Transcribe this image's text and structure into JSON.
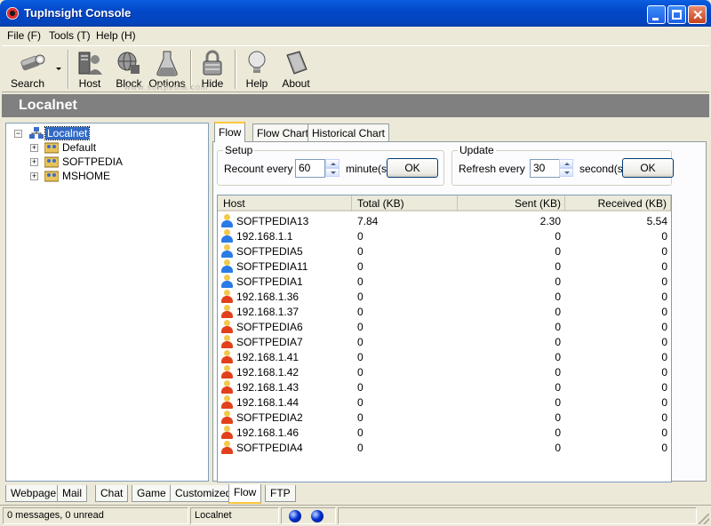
{
  "window": {
    "title": "TupInsight Console"
  },
  "menu": [
    "File (F)",
    "Tools (T)",
    "Help (H)"
  ],
  "toolbar": {
    "search": "Search",
    "host": "Host",
    "block": "Block",
    "options": "Options",
    "hide": "Hide",
    "help": "Help",
    "about": "About",
    "watermark": "www.softpedia.com"
  },
  "header": {
    "title": "Localnet"
  },
  "tree": {
    "root": "Localnet",
    "children": [
      "Default",
      "SOFTPEDIA",
      "MSHOME"
    ]
  },
  "tabs": [
    "Flow",
    "Flow Chart",
    "Historical Chart"
  ],
  "setup": {
    "legend": "Setup",
    "label": "Recount every",
    "value": "60",
    "unit": "minute(s)",
    "ok": "OK"
  },
  "update": {
    "legend": "Update",
    "label": "Refresh every",
    "value": "30",
    "unit": "second(s)",
    "ok": "OK"
  },
  "columns": [
    "Host",
    "Total (KB)",
    "Sent (KB)",
    "Received (KB)"
  ],
  "hosts": [
    {
      "host": "SOFTPEDIA13",
      "total": "7.84",
      "sent": "2.30",
      "received": "5.54",
      "status": "blue"
    },
    {
      "host": "192.168.1.1",
      "total": "0",
      "sent": "0",
      "received": "0",
      "status": "blue"
    },
    {
      "host": "SOFTPEDIA5",
      "total": "0",
      "sent": "0",
      "received": "0",
      "status": "blue"
    },
    {
      "host": "SOFTPEDIA11",
      "total": "0",
      "sent": "0",
      "received": "0",
      "status": "blue"
    },
    {
      "host": "SOFTPEDIA1",
      "total": "0",
      "sent": "0",
      "received": "0",
      "status": "blue"
    },
    {
      "host": "192.168.1.36",
      "total": "0",
      "sent": "0",
      "received": "0",
      "status": "red"
    },
    {
      "host": "192.168.1.37",
      "total": "0",
      "sent": "0",
      "received": "0",
      "status": "red"
    },
    {
      "host": "SOFTPEDIA6",
      "total": "0",
      "sent": "0",
      "received": "0",
      "status": "red"
    },
    {
      "host": "SOFTPEDIA7",
      "total": "0",
      "sent": "0",
      "received": "0",
      "status": "red"
    },
    {
      "host": "192.168.1.41",
      "total": "0",
      "sent": "0",
      "received": "0",
      "status": "red"
    },
    {
      "host": "192.168.1.42",
      "total": "0",
      "sent": "0",
      "received": "0",
      "status": "red"
    },
    {
      "host": "192.168.1.43",
      "total": "0",
      "sent": "0",
      "received": "0",
      "status": "red"
    },
    {
      "host": "192.168.1.44",
      "total": "0",
      "sent": "0",
      "received": "0",
      "status": "red"
    },
    {
      "host": "SOFTPEDIA2",
      "total": "0",
      "sent": "0",
      "received": "0",
      "status": "red"
    },
    {
      "host": "192.168.1.46",
      "total": "0",
      "sent": "0",
      "received": "0",
      "status": "red"
    },
    {
      "host": "SOFTPEDIA4",
      "total": "0",
      "sent": "0",
      "received": "0",
      "status": "red"
    }
  ],
  "bottom_tabs": [
    "Webpage",
    "Mail",
    "Chat",
    "Game",
    "Customized",
    "Flow",
    "FTP"
  ],
  "status": {
    "messages": "0 messages, 0 unread",
    "network": "Localnet"
  },
  "colors": {
    "online": "#2a7be8",
    "offline": "#e2401c",
    "accent": "#ffc83c",
    "header": "#808080"
  },
  "icons": [
    "search-icon",
    "host-icon",
    "block-icon",
    "options-icon",
    "hide-icon",
    "help-icon",
    "about-icon",
    "user-icon",
    "group-icon"
  ]
}
